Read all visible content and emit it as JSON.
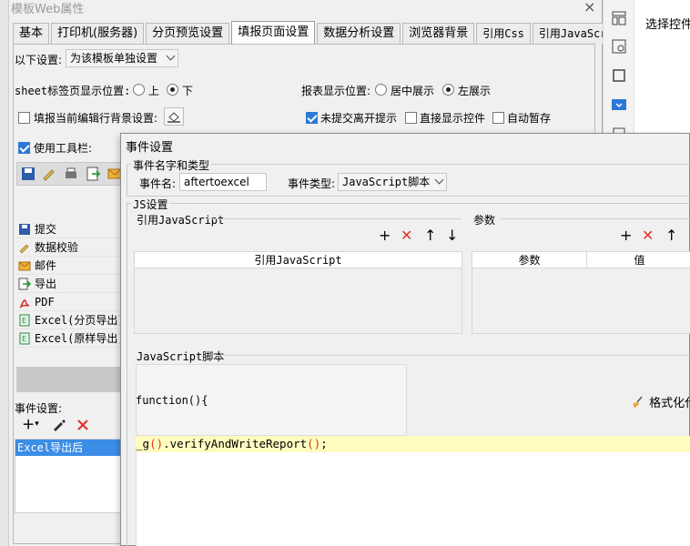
{
  "back_dialog": {
    "title": "模板Web属性",
    "close": "×",
    "tabs": [
      "基本",
      "打印机(服务器)",
      "分页预览设置",
      "填报页面设置",
      "数据分析设置",
      "浏览器背景",
      "引用Css",
      "引用JavaScript"
    ],
    "active_tab": 3,
    "settings_label": "以下设置:",
    "settings_value": "为该模板单独设置",
    "sheet_pos_label": "sheet标签页显示位置:",
    "sheet_pos_options": [
      "上",
      "下"
    ],
    "sheet_pos_selected": "下",
    "report_pos_label": "报表显示位置:",
    "report_pos_options": [
      "居中展示",
      "左展示"
    ],
    "report_pos_selected": "左展示",
    "fill_bg_label": "填报当前编辑行背景设置:",
    "unsubmitted_label": "未提交离开提示",
    "direct_show_label": "直接显示控件",
    "auto_save_label": "自动暂存",
    "use_toolbar_label": "使用工具栏:",
    "toolbar_items": [
      {
        "label": "提交",
        "icon": "submit-icon"
      },
      {
        "label": "数据校验",
        "icon": "pencil-check-icon"
      },
      {
        "label": "邮件",
        "icon": "mail-icon"
      },
      {
        "label": "导出",
        "icon": "export-icon"
      },
      {
        "label": "PDF",
        "icon": "pdf-icon"
      },
      {
        "label": "Excel(分页导出)",
        "icon": "excel-icon"
      },
      {
        "label": "Excel(原样导出)",
        "icon": "excel-icon"
      }
    ],
    "event_label": "事件设置:",
    "event_items": [
      "Excel导出后"
    ]
  },
  "front_dialog": {
    "title": "事件设置",
    "name_type_group": "事件名字和类型",
    "event_name_label": "事件名:",
    "event_name_value": "aftertoexcel",
    "event_type_label": "事件类型:",
    "event_type_value": "JavaScript脚本",
    "js_group": "JS设置",
    "ref_js_label": "引用JavaScript",
    "ref_js_header": "引用JavaScript",
    "params_label": "参数",
    "params_headers": [
      "参数",
      "值"
    ],
    "script_label": "JavaScript脚本",
    "code_line1": "function(){",
    "code_line2_prefix": "_g",
    "code_line2_body": ".verifyAndWriteReport",
    "code_line2_suffix": ";",
    "format_button": "格式化代码"
  },
  "right_panel": {
    "label": "选择控件"
  },
  "colors": {
    "selection_blue": "#3c8de6",
    "delete_red": "#e0332c",
    "highlight_yellow": "#fffcbf"
  }
}
